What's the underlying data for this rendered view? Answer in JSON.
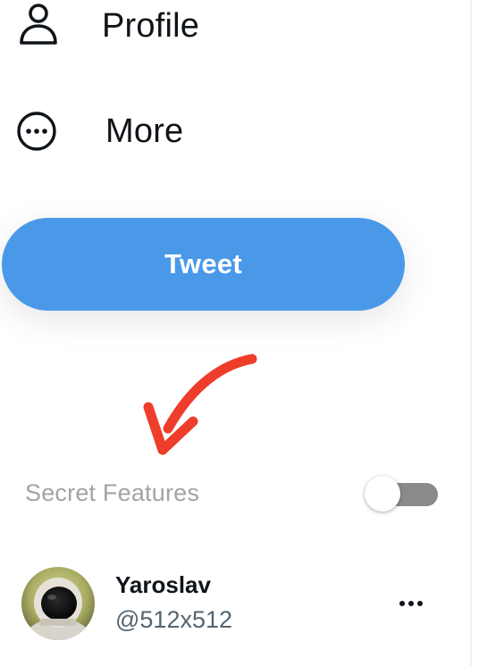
{
  "nav": {
    "items": [
      {
        "label": "Profile",
        "icon": "person-icon"
      },
      {
        "label": "More",
        "icon": "more-circle-icon"
      }
    ]
  },
  "tweet_button": {
    "label": "Tweet",
    "color": "#4a99e9"
  },
  "annotation": {
    "arrow_color": "#ee3d2a"
  },
  "secret_features": {
    "label": "Secret Features",
    "toggle_on": false
  },
  "account": {
    "name": "Yaroslav",
    "handle": "@512x512",
    "more_icon": "ellipsis-icon"
  }
}
